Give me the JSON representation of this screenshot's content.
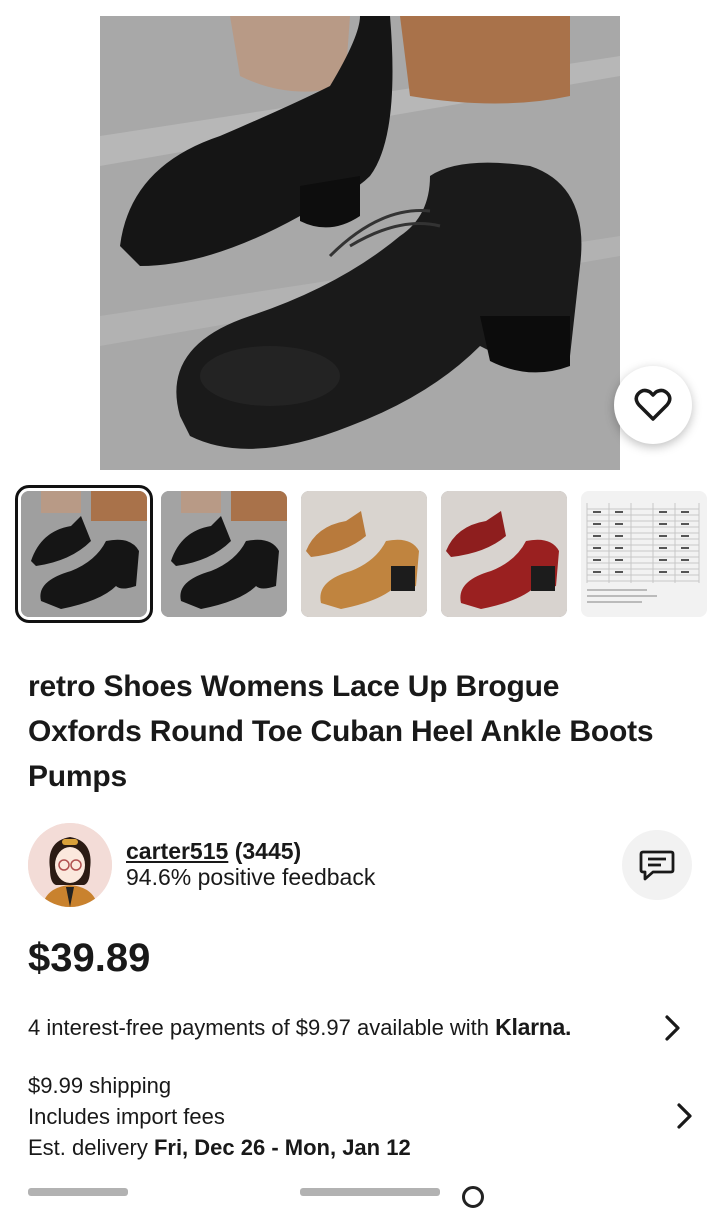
{
  "product": {
    "title": "retro Shoes Womens Lace Up Brogue Oxfords Round Toe Cuban Heel Ankle Boots Pumps",
    "price": "$39.89"
  },
  "gallery": {
    "thumbnails": [
      {
        "kind": "black-shoes",
        "selected": true
      },
      {
        "kind": "black-shoes-watermark",
        "selected": false
      },
      {
        "kind": "brown-shoes",
        "selected": false
      },
      {
        "kind": "red-shoes",
        "selected": false
      },
      {
        "kind": "size-chart",
        "selected": false
      }
    ]
  },
  "seller": {
    "name": "carter515",
    "count": "(3445)",
    "feedback": "94.6% positive feedback"
  },
  "payments": {
    "text": "4 interest-free payments of $9.97 available with",
    "provider": "Klarna."
  },
  "shipping": {
    "cost": "$9.99 shipping",
    "fees": "Includes import fees",
    "delivery_prefix": "Est. delivery ",
    "delivery_dates": "Fri, Dec 26 - Mon, Jan 12"
  },
  "icons": {
    "favorite": "heart-icon",
    "message": "chat-icon",
    "chevron": "chevron-right-icon"
  }
}
